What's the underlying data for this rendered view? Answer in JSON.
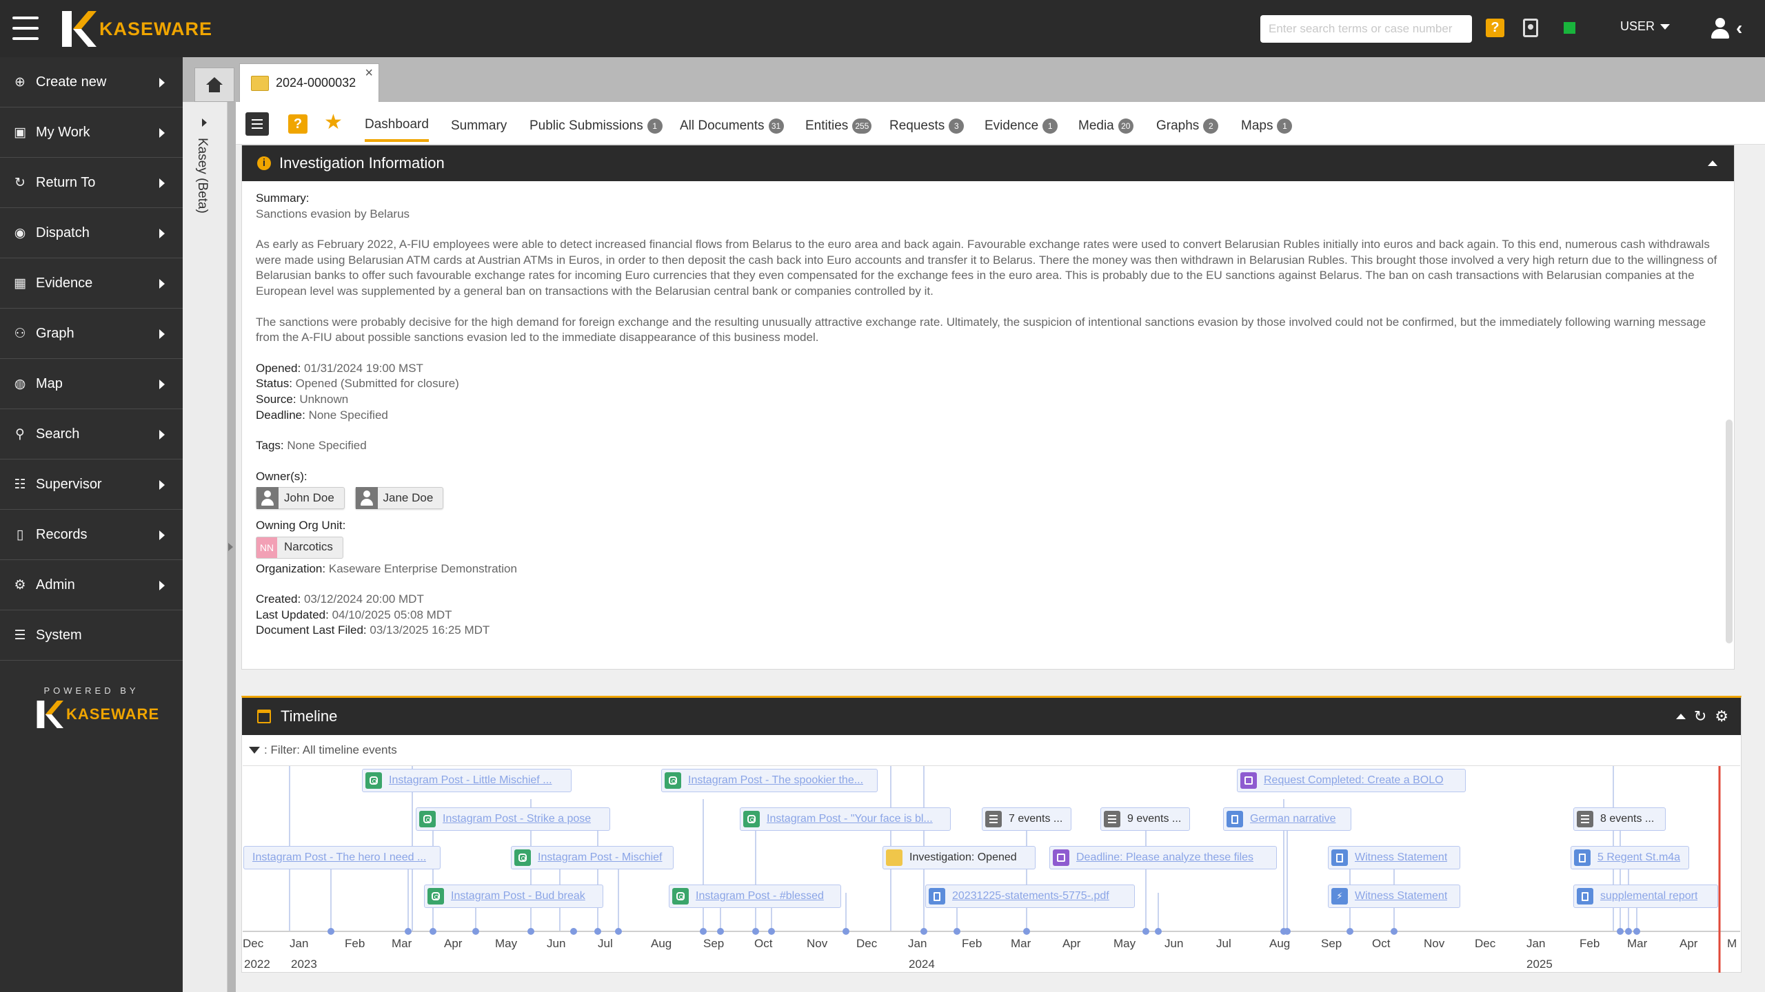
{
  "topbar": {
    "brand": "KASEWARE",
    "search_placeholder": "Enter search terms or case number",
    "user_label": "USER"
  },
  "sidebar": {
    "items": [
      {
        "label": "Create new",
        "icon": "plus-circle-icon"
      },
      {
        "label": "My Work",
        "icon": "briefcase-icon"
      },
      {
        "label": "Return To",
        "icon": "redo-icon"
      },
      {
        "label": "Dispatch",
        "icon": "podcast-icon"
      },
      {
        "label": "Evidence",
        "icon": "boxes-icon"
      },
      {
        "label": "Graph",
        "icon": "graph-icon"
      },
      {
        "label": "Map",
        "icon": "globe-icon"
      },
      {
        "label": "Search",
        "icon": "search-icon"
      },
      {
        "label": "Supervisor",
        "icon": "users-icon"
      },
      {
        "label": "Records",
        "icon": "file-icon"
      },
      {
        "label": "Admin",
        "icon": "cogs-icon"
      },
      {
        "label": "System",
        "icon": "server-icon"
      }
    ],
    "powered_by": "POWERED BY",
    "powered_brand": "KASEWARE"
  },
  "kasey": {
    "label": "Kasey (Beta)"
  },
  "case_tab": {
    "label": "2024-0000032",
    "close": "×"
  },
  "subtabs": [
    {
      "label": "Dashboard",
      "badge": null
    },
    {
      "label": "Summary",
      "badge": null
    },
    {
      "label": "Public Submissions",
      "badge": "1"
    },
    {
      "label": "All Documents",
      "badge": "31"
    },
    {
      "label": "Entities",
      "badge": "255"
    },
    {
      "label": "Requests",
      "badge": "3"
    },
    {
      "label": "Evidence",
      "badge": "1"
    },
    {
      "label": "Media",
      "badge": "20"
    },
    {
      "label": "Graphs",
      "badge": "2"
    },
    {
      "label": "Maps",
      "badge": "1"
    }
  ],
  "investigation": {
    "title": "Investigation Information",
    "summary_label": "Summary:",
    "summary_title": "Sanctions evasion by Belarus",
    "para1": "As early as February 2022, A-FIU employees were able to detect increased financial flows from Belarus to the euro area and back again. Favourable exchange rates were used to convert Belarusian Rubles initially into euros and back again. To this end, numerous cash withdrawals were made using Belarusian ATM cards at Austrian ATMs in Euros, in order to then deposit the cash back into Euro accounts and transfer it to Belarus. There the money was then withdrawn in Belarusian Rubles. This brought those involved a very high return due to the willingness of Belarusian banks to offer such favourable exchange rates for incoming Euro currencies that they even compensated for the exchange fees in the euro area. This is probably due to the EU sanctions against Belarus. The ban on cash transactions with Belarusian companies at the European level was supplemented by a general ban on transactions with the Belarusian central bank or companies controlled by it.",
    "para2": "The sanctions were probably decisive for the high demand for foreign exchange and the resulting unusually attractive exchange rate. Ultimately, the suspicion of intentional sanctions evasion by those involved could not be confirmed, but the immediately following warning message from the A-FIU about possible sanctions evasion led to the immediate disappearance of this business model.",
    "opened_label": "Opened:",
    "opened": "01/31/2024 19:00 MST",
    "status_label": "Status:",
    "status": "Opened (Submitted for closure)",
    "source_label": "Source:",
    "source": "Unknown",
    "deadline_label": "Deadline:",
    "deadline": "None Specified",
    "tags_label": "Tags:",
    "tags": "None Specified",
    "owners_label": "Owner(s):",
    "owners": [
      "John Doe",
      "Jane Doe"
    ],
    "org_unit_label": "Owning Org Unit:",
    "org_unit_initials": "NN",
    "org_unit": "Narcotics",
    "organization_label": "Organization:",
    "organization": "Kaseware Enterprise Demonstration",
    "created_label": "Created:",
    "created": "03/12/2024 20:00 MDT",
    "updated_label": "Last Updated:",
    "updated": "04/10/2025 05:08 MDT",
    "filed_label": "Document Last Filed:",
    "filed": "03/13/2025 16:25 MDT"
  },
  "timeline": {
    "title": "Timeline",
    "filter": ": Filter: All timeline events",
    "events": [
      {
        "label": "Instagram Post - Little Mischief ...",
        "type": "instagram"
      },
      {
        "label": "Instagram Post - Strike a pose",
        "type": "instagram"
      },
      {
        "label": "Instagram Post - The hero I need ...",
        "type": "instagram"
      },
      {
        "label": "Instagram Post - Mischief",
        "type": "instagram"
      },
      {
        "label": "Instagram Post - Bud break",
        "type": "instagram"
      },
      {
        "label": "Instagram Post - The spookier the...",
        "type": "instagram"
      },
      {
        "label": "Instagram Post - \"Your face is bl...",
        "type": "instagram"
      },
      {
        "label": "Instagram Post - #blessed",
        "type": "instagram"
      },
      {
        "label": "7 events ...",
        "type": "group"
      },
      {
        "label": "9 events ...",
        "type": "group"
      },
      {
        "label": "Investigation: Opened",
        "type": "case"
      },
      {
        "label": "Deadline: Please analyze these files",
        "type": "task"
      },
      {
        "label": "20231225-statements-5775-.pdf",
        "type": "document"
      },
      {
        "label": "Request Completed: Create a BOLO",
        "type": "task"
      },
      {
        "label": "German narrative",
        "type": "document"
      },
      {
        "label": "Witness Statement",
        "type": "document"
      },
      {
        "label": "Witness Statement",
        "type": "flash"
      },
      {
        "label": "8 events ...",
        "type": "group"
      },
      {
        "label": "5 Regent St.m4a",
        "type": "document"
      },
      {
        "label": "supplemental report",
        "type": "document"
      }
    ],
    "months": [
      "Dec",
      "Jan",
      "Feb",
      "Mar",
      "Apr",
      "May",
      "Jun",
      "Jul",
      "Aug",
      "Sep",
      "Oct",
      "Nov",
      "Dec",
      "Jan",
      "Feb",
      "Mar",
      "Apr",
      "May",
      "Jun",
      "Jul",
      "Aug",
      "Sep",
      "Oct",
      "Nov",
      "Dec",
      "Jan",
      "Feb",
      "Mar",
      "Apr",
      "M"
    ],
    "years": [
      "2022",
      "2023",
      "2024",
      "2025"
    ]
  }
}
